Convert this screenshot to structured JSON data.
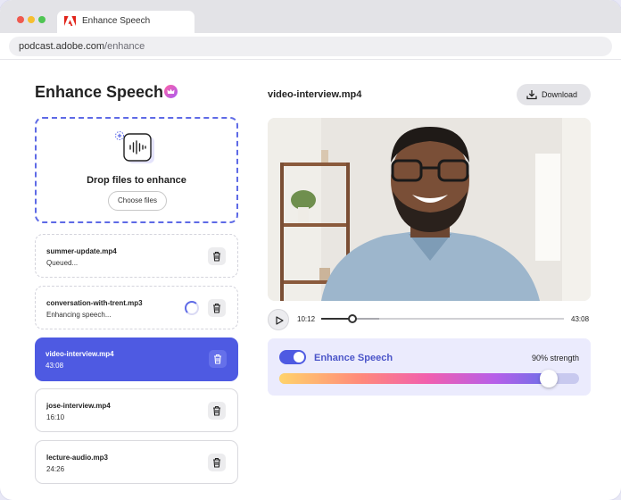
{
  "browser": {
    "tab_title": "Enhance Speech",
    "url_domain": "podcast.adobe.com",
    "url_path": "/enhance"
  },
  "app": {
    "title": "Enhance Speech"
  },
  "dropzone": {
    "text": "Drop files to enhance",
    "button_label": "Choose files"
  },
  "files": [
    {
      "name": "summer-update.mp4",
      "status": "Queued..."
    },
    {
      "name": "conversation-with-trent.mp3",
      "status": "Enhancing speech..."
    },
    {
      "name": "video-interview.mp4",
      "status": "43:08"
    },
    {
      "name": "jose-interview.mp4",
      "status": "16:10"
    },
    {
      "name": "lecture-audio.mp3",
      "status": "24:26"
    }
  ],
  "player": {
    "file_title": "video-interview.mp4",
    "download_label": "Download",
    "current_time": "10:12",
    "total_time": "43:08",
    "progress_percent": 13,
    "buffered_percent": 24
  },
  "enhance": {
    "label": "Enhance Speech",
    "enabled": true,
    "strength_text": "90% strength",
    "strength_percent": 90
  },
  "colors": {
    "accent": "#4e5ae2",
    "brand_red": "#e1251b"
  },
  "icons": {
    "logo": "adobe-logo-icon",
    "badge": "crown-icon",
    "upload": "waveform-upload-icon",
    "delete": "trash-icon",
    "download": "download-icon",
    "play": "play-icon"
  }
}
